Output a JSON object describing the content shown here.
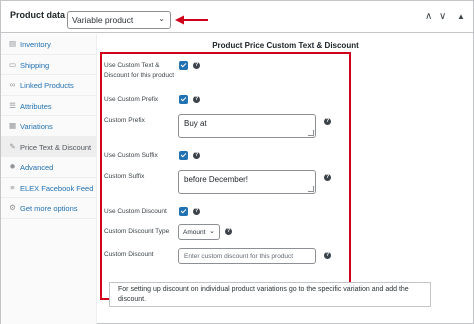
{
  "header": {
    "label": "Product data",
    "dash": "—",
    "product_type": "Variable product",
    "collapse_up": "∧",
    "collapse_down": "∨",
    "toggle": "▲",
    "accent": "#d0021b"
  },
  "sidebar": {
    "items": [
      {
        "label": "Inventory",
        "icon": "inventory-icon"
      },
      {
        "label": "Shipping",
        "icon": "truck-icon"
      },
      {
        "label": "Linked Products",
        "icon": "link-icon"
      },
      {
        "label": "Attributes",
        "icon": "list-icon"
      },
      {
        "label": "Variations",
        "icon": "grid-icon"
      },
      {
        "label": "Price Text & Discount",
        "icon": "wrench-icon"
      },
      {
        "label": "Advanced",
        "icon": "gear-icon"
      },
      {
        "label": "ELEX Facebook Feed",
        "icon": "feed-icon"
      },
      {
        "label": "Get more options",
        "icon": "plugin-icon"
      }
    ],
    "active_index": 5
  },
  "main": {
    "section_title": "Product Price Custom Text & Discount",
    "use_custom_text_label": "Use Custom Text & Discount for this product",
    "use_custom_prefix_label": "Use Custom Prefix",
    "custom_prefix_label": "Custom Prefix",
    "custom_prefix_value": "Buy at",
    "use_custom_suffix_label": "Use Custom Suffix",
    "custom_suffix_label": "Custom Suffix",
    "custom_suffix_value": "before December!",
    "use_custom_discount_label": "Use Custom Discount",
    "custom_discount_type_label": "Custom Discount Type",
    "custom_discount_type_value": "Amount",
    "custom_discount_label": "Custom Discount",
    "custom_discount_placeholder": "Enter custom discount for this product",
    "notice": "For setting up discount on individual product variations go to the specific variation and add the discount."
  }
}
